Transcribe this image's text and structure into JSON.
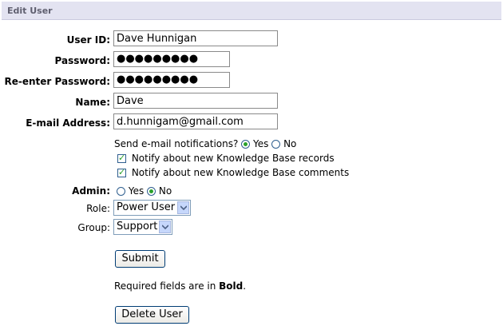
{
  "header": {
    "title": "Edit User"
  },
  "form": {
    "user_id": {
      "label": "User ID:",
      "value": "Dave Hunnigan"
    },
    "password": {
      "label": "Password:",
      "value": "●●●●●●●●●"
    },
    "reenter_password": {
      "label": "Re-enter Password:",
      "value": "●●●●●●●●●"
    },
    "name": {
      "label": "Name:",
      "value": "Dave"
    },
    "email": {
      "label": "E-mail Address:",
      "value": "d.hunnigam@gmail.com"
    },
    "notifications": {
      "question": "Send e-mail notifications?",
      "yes_label": "Yes",
      "no_label": "No",
      "selected": "Yes"
    },
    "notify_records": {
      "label": "Notify about new Knowledge Base records",
      "checked": true
    },
    "notify_comments": {
      "label": "Notify about new Knowledge Base comments",
      "checked": true
    },
    "admin": {
      "label": "Admin:",
      "yes_label": "Yes",
      "no_label": "No",
      "selected": "No"
    },
    "role": {
      "label": "Role:",
      "value": "Power User"
    },
    "group": {
      "label": "Group:",
      "value": "Support"
    },
    "submit_label": "Submit",
    "required_note_prefix": "Required fields are in ",
    "required_note_bold": "Bold",
    "required_note_suffix": ".",
    "delete_label": "Delete User"
  },
  "colors": {
    "header_bg": "#e3e3f1",
    "radio_check_mark": "#2aa12a",
    "button_border": "#003c74"
  }
}
